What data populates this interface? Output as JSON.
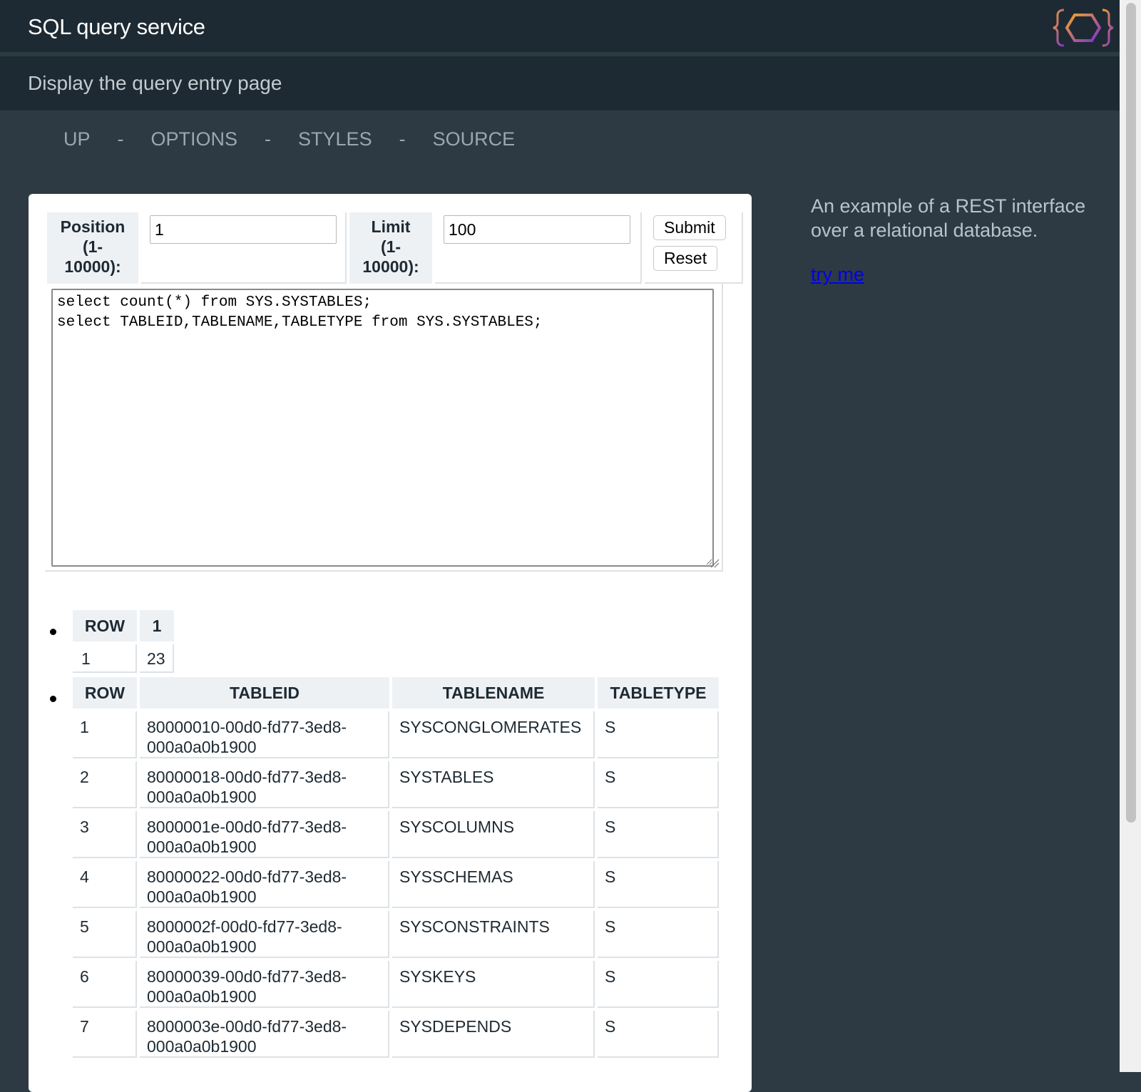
{
  "header": {
    "title": "SQL query service"
  },
  "subheader": {
    "text": "Display the query entry page"
  },
  "nav": {
    "items": [
      "UP",
      "OPTIONS",
      "STYLES",
      "SOURCE"
    ],
    "separator": "-"
  },
  "form": {
    "position_label": "Position (1-10000):",
    "position_value": "1",
    "limit_label": "Limit (1-10000):",
    "limit_value": "100",
    "submit_label": "Submit",
    "reset_label": "Reset",
    "sql": "select count(*) from SYS.SYSTABLES;\nselect TABLEID,TABLENAME,TABLETYPE from SYS.SYSTABLES;"
  },
  "result1": {
    "headers": [
      "ROW",
      "1"
    ],
    "rows": [
      [
        "1",
        "23"
      ]
    ]
  },
  "result2": {
    "headers": [
      "ROW",
      "TABLEID",
      "TABLENAME",
      "TABLETYPE"
    ],
    "rows": [
      [
        "1",
        "80000010-00d0-fd77-3ed8-000a0a0b1900",
        "SYSCONGLOMERATES",
        "S"
      ],
      [
        "2",
        "80000018-00d0-fd77-3ed8-000a0a0b1900",
        "SYSTABLES",
        "S"
      ],
      [
        "3",
        "8000001e-00d0-fd77-3ed8-000a0a0b1900",
        "SYSCOLUMNS",
        "S"
      ],
      [
        "4",
        "80000022-00d0-fd77-3ed8-000a0a0b1900",
        "SYSSCHEMAS",
        "S"
      ],
      [
        "5",
        "8000002f-00d0-fd77-3ed8-000a0a0b1900",
        "SYSCONSTRAINTS",
        "S"
      ],
      [
        "6",
        "80000039-00d0-fd77-3ed8-000a0a0b1900",
        "SYSKEYS",
        "S"
      ],
      [
        "7",
        "8000003e-00d0-fd77-3ed8-000a0a0b1900",
        "SYSDEPENDS",
        "S"
      ]
    ]
  },
  "side": {
    "description": "An example of a REST interface over a relational database.",
    "link_text": "try me"
  },
  "colors": {
    "header_bg": "#1e2a33",
    "page_bg": "#2d3a44",
    "link": "#0000ee",
    "logo_orange": "#f5a623",
    "logo_purple": "#7b2fd6"
  }
}
